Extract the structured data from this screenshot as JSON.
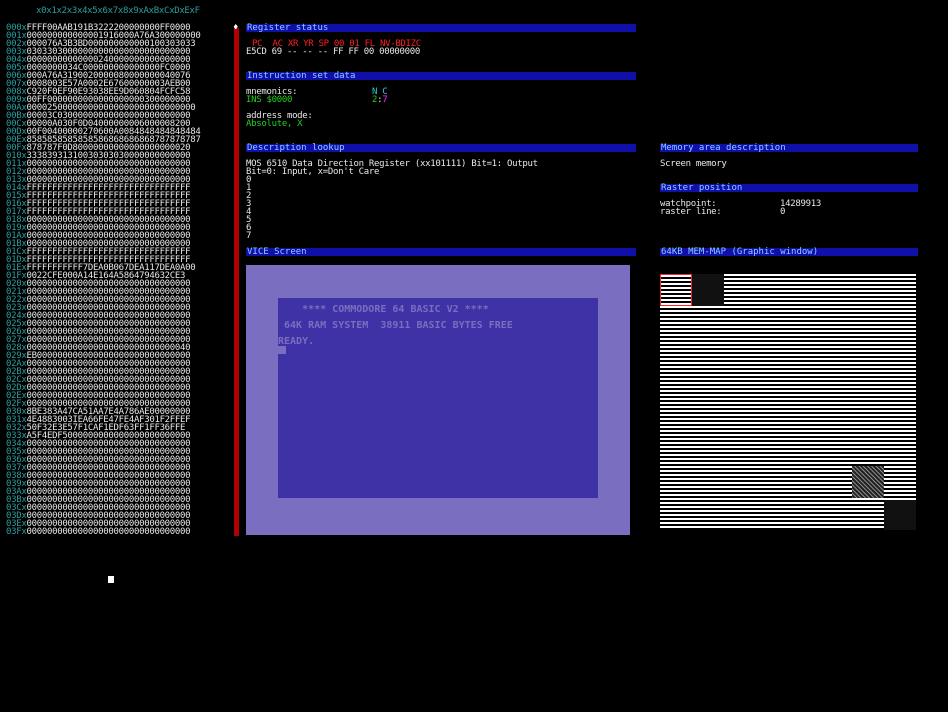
{
  "memdump": {
    "header": "x0x1x2x3x4x5x6x7x8x9xAxBxCxDxExF",
    "rows": [
      {
        "addr": "000x",
        "data": "FFFF00AAB191B3222200000000FF0000"
      },
      {
        "addr": "001x",
        "data": "000000000000001916000A76A300000000"
      },
      {
        "addr": "002x",
        "data": "000076A3B3BD000000000000100303033"
      },
      {
        "addr": "003x",
        "data": "03033030000000000000000000000000"
      },
      {
        "addr": "004x",
        "data": "00000000000000240000000000000000"
      },
      {
        "addr": "005x",
        "data": "0000000034C000000000000000FC0000"
      },
      {
        "addr": "006x",
        "data": "000A76A3190020000080000000040076"
      },
      {
        "addr": "007x",
        "data": "0008003E57A0002E67600000003AEB00"
      },
      {
        "addr": "008x",
        "data": "C920F0EF90E93038EE9D060804FCFC58"
      },
      {
        "addr": "009x",
        "data": "00FF0000000000000000000300000000"
      },
      {
        "addr": "00Ax",
        "data": "000025000000000000000000000000000"
      },
      {
        "addr": "00Bx",
        "data": "00003C03000000000000000000000000"
      },
      {
        "addr": "00Cx",
        "data": "00000A030F0D04000000006000008200"
      },
      {
        "addr": "00Dx",
        "data": "00F00400000270600A0084848484848484"
      },
      {
        "addr": "00Ex",
        "data": "8585858585858586868686868787878787"
      },
      {
        "addr": "00Fx",
        "data": "878787F0D80000000000000000000020"
      },
      {
        "addr": "010x",
        "data": "33383931310030303030000000000000"
      },
      {
        "addr": "011x",
        "data": "00000000000000000000000000000000"
      },
      {
        "addr": "012x",
        "data": "00000000000000000000000000000000"
      },
      {
        "addr": "013x",
        "data": "00000000000000000000000000000000"
      },
      {
        "addr": "014x",
        "data": "FFFFFFFFFFFFFFFFFFFFFFFFFFFFFFFF"
      },
      {
        "addr": "015x",
        "data": "FFFFFFFFFFFFFFFFFFFFFFFFFFFFFFFF"
      },
      {
        "addr": "016x",
        "data": "FFFFFFFFFFFFFFFFFFFFFFFFFFFFFFFF"
      },
      {
        "addr": "017x",
        "data": "FFFFFFFFFFFFFFFFFFFFFFFFFFFFFFFF"
      },
      {
        "addr": "018x",
        "data": "00000000000000000000000000000000"
      },
      {
        "addr": "019x",
        "data": "00000000000000000000000000000000"
      },
      {
        "addr": "01Ax",
        "data": "00000000000000000000000000000000"
      },
      {
        "addr": "01Bx",
        "data": "00000000000000000000000000000000"
      },
      {
        "addr": "01Cx",
        "data": "FFFFFFFFFFFFFFFFFFFFFFFFFFFFFFFF"
      },
      {
        "addr": "01Dx",
        "data": "FFFFFFFFFFFFFFFFFFFFFFFFFFFFFFFF"
      },
      {
        "addr": "01Ex",
        "data": "FFFFFFFFFFF7DEA0B067DEA117DEA0A00"
      },
      {
        "addr": "01Fx",
        "data": "0022CFE000A14E164A5864794632CE3"
      },
      {
        "addr": "020x",
        "data": "00000000000000000000000000000000"
      },
      {
        "addr": "021x",
        "data": "00000000000000000000000000000000"
      },
      {
        "addr": "022x",
        "data": "00000000000000000000000000000000"
      },
      {
        "addr": "023x",
        "data": "00000000000000000000000000000000"
      },
      {
        "addr": "024x",
        "data": "00000000000000000000000000000000"
      },
      {
        "addr": "025x",
        "data": "00000000000000000000000000000000"
      },
      {
        "addr": "026x",
        "data": "00000000000000000000000000000000"
      },
      {
        "addr": "027x",
        "data": "00000000000000000000000000000000"
      },
      {
        "addr": "028x",
        "data": "00000000000000000000000000000040"
      },
      {
        "addr": "029x",
        "data": "EB000000000000000000000000000000"
      },
      {
        "addr": "02Ax",
        "data": "00000000000000000000000000000000"
      },
      {
        "addr": "02Bx",
        "data": "00000000000000000000000000000000"
      },
      {
        "addr": "02Cx",
        "data": "00000000000000000000000000000000"
      },
      {
        "addr": "02Dx",
        "data": "00000000000000000000000000000000"
      },
      {
        "addr": "02Ex",
        "data": "00000000000000000000000000000000"
      },
      {
        "addr": "02Fx",
        "data": "00000000000000000000000000000000"
      },
      {
        "addr": "030x",
        "data": "8BE383A47CA51AA7E4A786AE00000000"
      },
      {
        "addr": "031x",
        "data": "4E4883003IEA66FE47FE4AF301F2FFEF"
      },
      {
        "addr": "032x",
        "data": "50F32E3E57F1CAF1EDF63FF1FF36FFE"
      },
      {
        "addr": "033x",
        "data": "A5F4EDF5000000000000000000000000"
      },
      {
        "addr": "034x",
        "data": "00000000000000000000000000000000"
      },
      {
        "addr": "035x",
        "data": "00000000000000000000000000000000"
      },
      {
        "addr": "036x",
        "data": "00000000000000000000000000000000"
      },
      {
        "addr": "037x",
        "data": "00000000000000000000000000000000"
      },
      {
        "addr": "038x",
        "data": "00000000000000000000000000000000"
      },
      {
        "addr": "039x",
        "data": "00000000000000000000000000000000"
      },
      {
        "addr": "03Ax",
        "data": "00000000000000000000000000000000"
      },
      {
        "addr": "03Bx",
        "data": "00000000000000000000000000000000"
      },
      {
        "addr": "03Cx",
        "data": "00000000000000000000000000000000"
      },
      {
        "addr": "03Dx",
        "data": "00000000000000000000000000000000"
      },
      {
        "addr": "03Ex",
        "data": "00000000000000000000000000000000"
      },
      {
        "addr": "03Fx",
        "data": "00000000000000000000000000000000"
      }
    ]
  },
  "register": {
    "title": "Register status",
    "header": "PC  AC XR YR SP 00 01 FL NV-BDIZC",
    "values": "E5CD 69 -- -- -- FF FF 00 00000000"
  },
  "instruction": {
    "title": "Instruction set data",
    "mnemonics_label": "mnemonics:",
    "nc_label": "N C",
    "ins_value": "INS $0000",
    "count_a": "2",
    "count_sep": ":",
    "count_b": "7",
    "mode_label": "address mode:",
    "mode_value": "Absolute, X"
  },
  "description": {
    "title": "Description lookup",
    "line1": "MOS 6510 Data Direction Register (xx101111) Bit=1: Output",
    "line2": "Bit=0: Input, x=Don't Care",
    "bits": [
      "0",
      "1",
      "2",
      "3",
      "4",
      "5",
      "6",
      "7"
    ]
  },
  "memarea": {
    "title": "Memory area description",
    "text": "Screen memory"
  },
  "raster": {
    "title": "Raster position",
    "watch_label": "watchpoint:",
    "watch_value": "14289913",
    "line_label": "raster line:",
    "line_value": "0"
  },
  "vice": {
    "title": "VICE Screen",
    "line1": "    **** COMMODORE 64 BASIC V2 ****",
    "line2": " 64K RAM SYSTEM  38911 BASIC BYTES FREE",
    "line3": "READY."
  },
  "memmap": {
    "title": "64KB MEM-MAP (Graphic window)"
  }
}
